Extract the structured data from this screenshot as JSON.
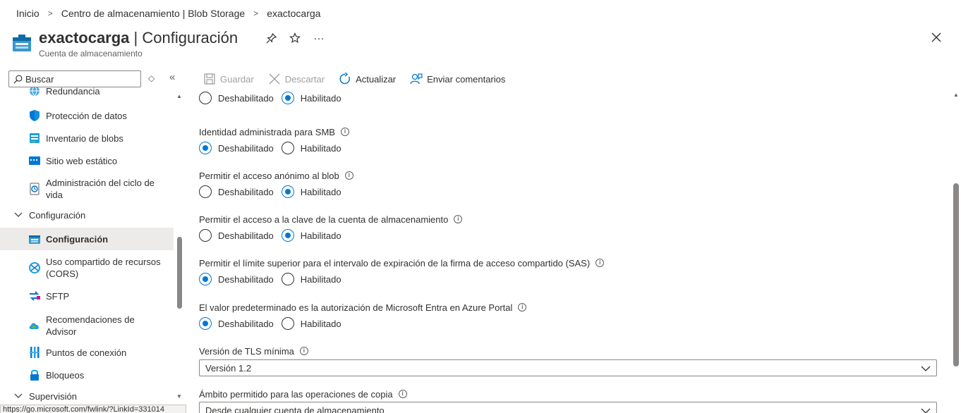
{
  "breadcrumb": [
    "Inicio",
    "Centro de almacenamiento | Blob Storage",
    "exactocarga"
  ],
  "header": {
    "resource_name": "exactocarga",
    "separator": " | ",
    "page_name": "Configuración",
    "subtitle": "Cuenta de almacenamiento",
    "more": "···"
  },
  "sidebar": {
    "search_placeholder": "Buscar",
    "collapse": "«",
    "expand": "◇",
    "items": [
      {
        "label": "Redundancia",
        "icon": "globe-icon"
      },
      {
        "label": "Protección de datos",
        "icon": "shield-icon"
      },
      {
        "label": "Inventario de blobs",
        "icon": "inventory-icon"
      },
      {
        "label": "Sitio web estático",
        "icon": "website-icon"
      },
      {
        "label": "Administración del ciclo de vida",
        "icon": "lifecycle-icon"
      },
      {
        "label": "Configuración",
        "icon": "storage-config-icon"
      },
      {
        "label": "Uso compartido de recursos (CORS)",
        "icon": "cors-icon"
      },
      {
        "label": "SFTP",
        "icon": "sftp-icon"
      },
      {
        "label": "Recomendaciones de Advisor",
        "icon": "advisor-icon"
      },
      {
        "label": "Puntos de conexión",
        "icon": "endpoints-icon"
      },
      {
        "label": "Bloqueos",
        "icon": "lock-icon"
      }
    ],
    "groups": {
      "configuracion": "Configuración",
      "supervision": "Supervisión"
    }
  },
  "status_url": "https://go.microsoft.com/fwlink/?LinkId=331014",
  "toolbar": {
    "save": "Guardar",
    "discard": "Descartar",
    "refresh": "Actualizar",
    "feedback": "Enviar comentarios"
  },
  "radio_options": {
    "off": "Deshabilitado",
    "on": "Habilitado"
  },
  "settings": [
    {
      "label": "",
      "selected": "on"
    },
    {
      "label": "Identidad administrada para SMB",
      "selected": "off"
    },
    {
      "label": "Permitir el acceso anónimo al blob",
      "selected": "on"
    },
    {
      "label": "Permitir el acceso a la clave de la cuenta de almacenamiento",
      "selected": "on"
    },
    {
      "label": "Permitir el límite superior para el intervalo de expiración de la firma de acceso compartido (SAS)",
      "selected": "off"
    },
    {
      "label": "El valor predeterminado es la autorización de Microsoft Entra en Azure Portal",
      "selected": "off"
    }
  ],
  "tls": {
    "label": "Versión de TLS mínima",
    "value": "Versión 1.2"
  },
  "copy_scope": {
    "label": "Ámbito permitido para las operaciones de copia",
    "value": "Desde cualquier cuenta de almacenamiento"
  },
  "colors": {
    "accent": "#0078d4",
    "selected_bg": "#edebe9"
  }
}
